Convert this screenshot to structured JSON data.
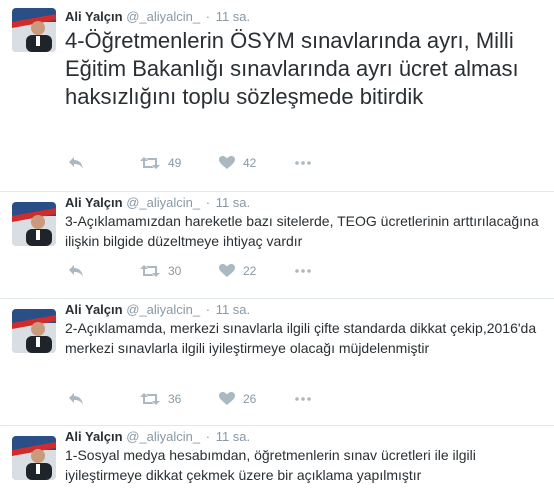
{
  "tweets": [
    {
      "name": "Ali Yalçın",
      "handle": "@_aliyalcin_",
      "time": "11 sa.",
      "text": "4-Öğretmenlerin ÖSYM sınavlarında ayrı, Milli Eğitim Bakanlığı sınavlarında ayrı ücret alması haksızlığını toplu sözleşmede bitirdik",
      "retweets": "49",
      "likes": "42"
    },
    {
      "name": "Ali Yalçın",
      "handle": "@_aliyalcin_",
      "time": "11 sa.",
      "text": "3-Açıklamamızdan hareketle bazı sitelerde,  TEOG ücretlerinin arttırılacağına ilişkin bilgide düzeltmeye ihtiyaç vardır",
      "retweets": "30",
      "likes": "22"
    },
    {
      "name": "Ali Yalçın",
      "handle": "@_aliyalcin_",
      "time": "11 sa.",
      "text": "2-Açıklamamda, merkezi sınavlarla ilgili çifte standarda dikkat çekip,2016'da merkezi sınavlarla ilgili iyileştirmeye olacağı müjdelenmiştir",
      "retweets": "36",
      "likes": "26"
    },
    {
      "name": "Ali Yalçın",
      "handle": "@_aliyalcin_",
      "time": "11 sa.",
      "text": "1-Sosyal medya hesabımdan, öğretmenlerin sınav ücretleri ile ilgili iyileştirmeye dikkat çekmek üzere bir açıklama yapılmıştır"
    }
  ],
  "colors": {
    "text": "#292f33",
    "muted": "#8899a6",
    "icon": "#aab8c2",
    "divider": "#e1e8ed"
  },
  "icons": [
    "reply-icon",
    "retweet-icon",
    "like-icon",
    "more-icon"
  ]
}
